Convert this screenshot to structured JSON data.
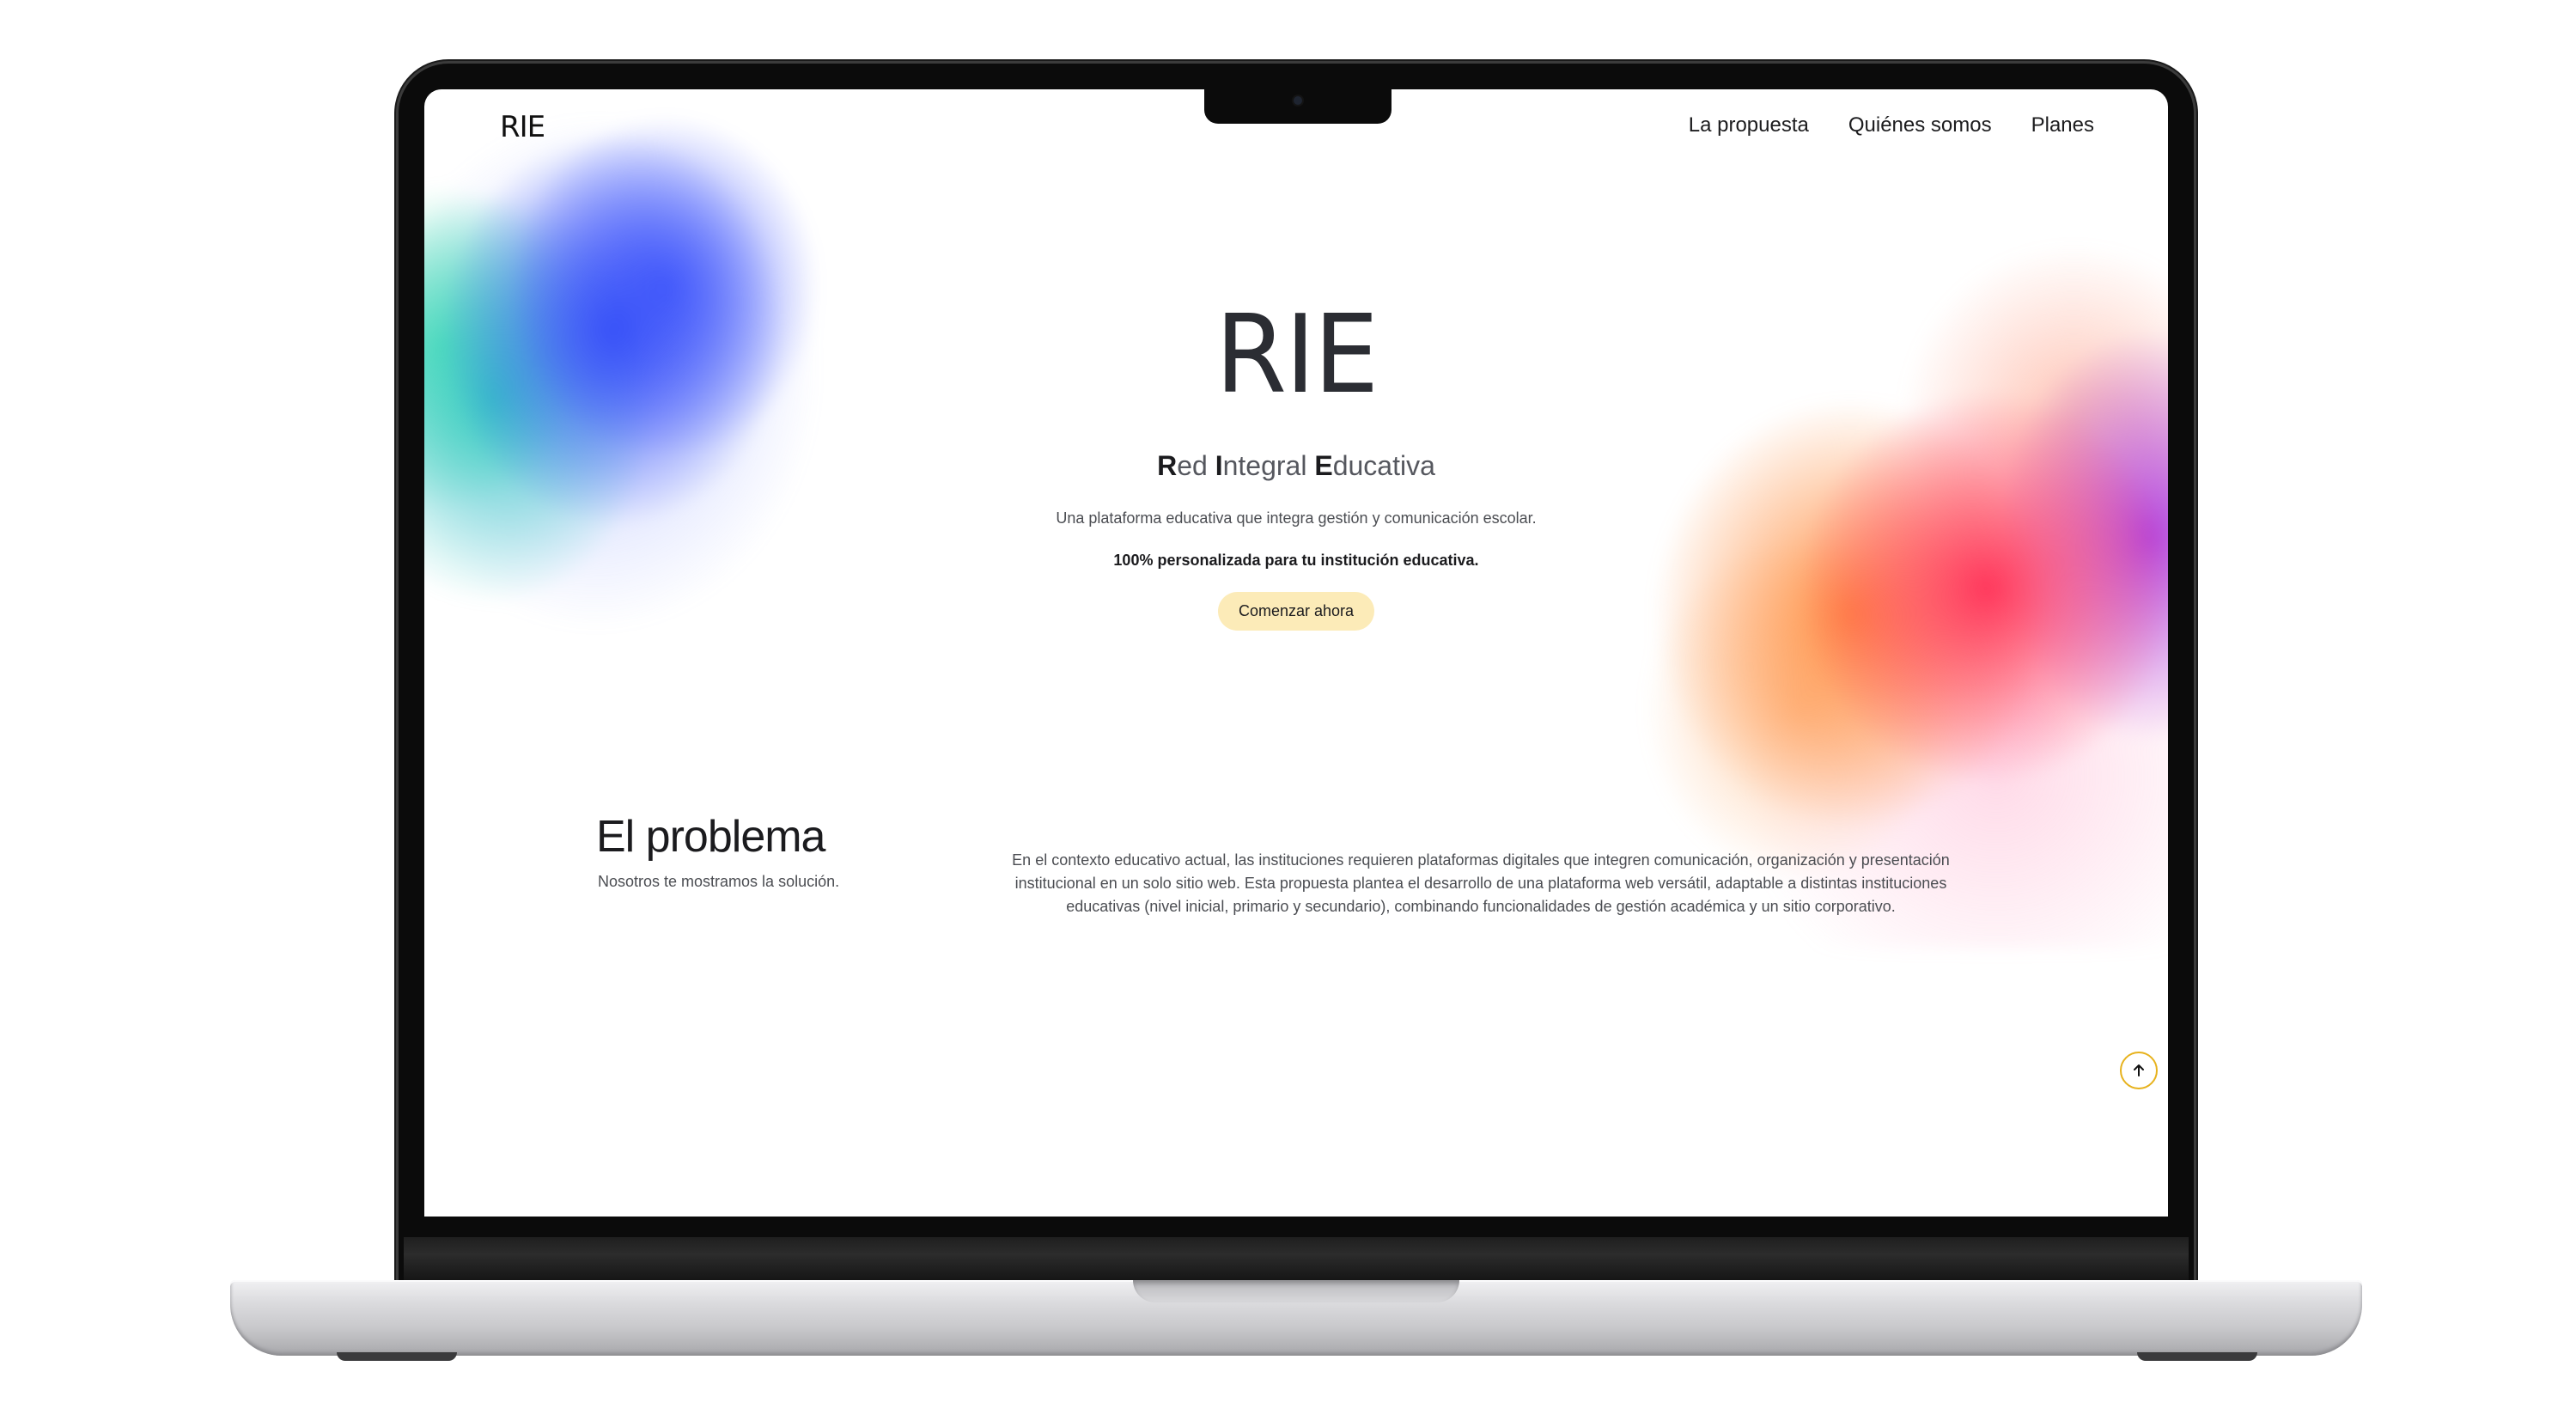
{
  "header": {
    "logo": "RIE",
    "nav": [
      "La propuesta",
      "Quiénes somos",
      "Planes"
    ]
  },
  "hero": {
    "title": "RIE",
    "subtitle": {
      "r_initial": "R",
      "r_rest": "ed ",
      "i_initial": "I",
      "i_rest": "ntegral ",
      "e_initial": "E",
      "e_rest": "ducativa"
    },
    "description": "Una plataforma educativa que integra gestión y comunicación escolar.",
    "tagline": "100% personalizada para tu institución educativa.",
    "cta_label": "Comenzar ahora"
  },
  "problem": {
    "title": "El problema",
    "subtitle": "Nosotros te mostramos la solución.",
    "text": "En el contexto educativo actual, las instituciones requieren plataformas digitales que integren comunicación, organización y presentación institucional en un solo sitio web. Esta propuesta plantea el desarrollo de una plataforma web versátil, adaptable a distintas instituciones educativas (nivel inicial, primario y secundario), combinando funcionalidades de gestión académica y un sitio corporativo."
  },
  "icons": {
    "scroll_top": "arrow-up-icon"
  },
  "colors": {
    "cta_background": "#fcebb8",
    "scroll_top_border": "#e7b21d",
    "splash_blue": "#344ef8",
    "splash_teal": "#28c8be",
    "splash_orange": "#ff8c3c",
    "splash_red": "#ff2d55",
    "splash_purple": "#aa32dc"
  }
}
